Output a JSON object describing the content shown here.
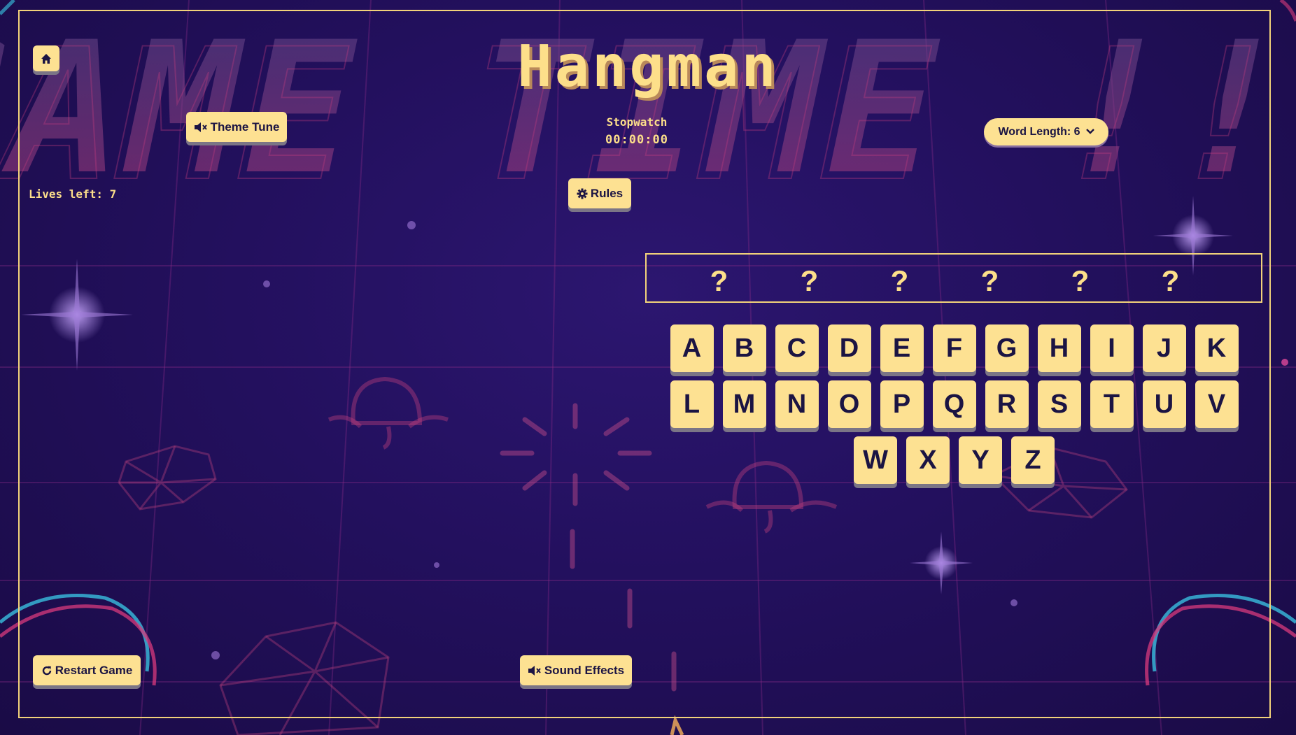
{
  "header": {
    "title": "Hangman",
    "background_text": "GAME TIME !!!"
  },
  "toolbar": {
    "home_icon": "home-icon",
    "theme_tune_label": "Theme Tune",
    "theme_tune_icon": "speaker-muted-icon",
    "rules_label": "Rules",
    "rules_icon": "gear-icon",
    "restart_label": "Restart Game",
    "restart_icon": "redo-icon",
    "sound_effects_label": "Sound Effects",
    "sound_effects_icon": "speaker-muted-icon"
  },
  "stopwatch": {
    "label": "Stopwatch",
    "time": "00:00:00"
  },
  "word_length": {
    "label": "Word Length: 6",
    "icon": "chevron-down-icon"
  },
  "status": {
    "lives_text": "Lives left: 7"
  },
  "word": {
    "slots": [
      "?",
      "?",
      "?",
      "?",
      "?",
      "?"
    ]
  },
  "keyboard": {
    "rows": [
      [
        "A",
        "B",
        "C",
        "D",
        "E",
        "F",
        "G",
        "H",
        "I",
        "J",
        "K"
      ],
      [
        "L",
        "M",
        "N",
        "O",
        "P",
        "Q",
        "R",
        "S",
        "T",
        "U",
        "V"
      ],
      [
        "W",
        "X",
        "Y",
        "Z"
      ]
    ]
  },
  "colors": {
    "accent": "#fddf8a",
    "button": "#fde192",
    "button_text": "#1b1443",
    "background": "#23105e",
    "neon_pink": "#d83a7c",
    "neon_cyan": "#3bc9e8"
  }
}
